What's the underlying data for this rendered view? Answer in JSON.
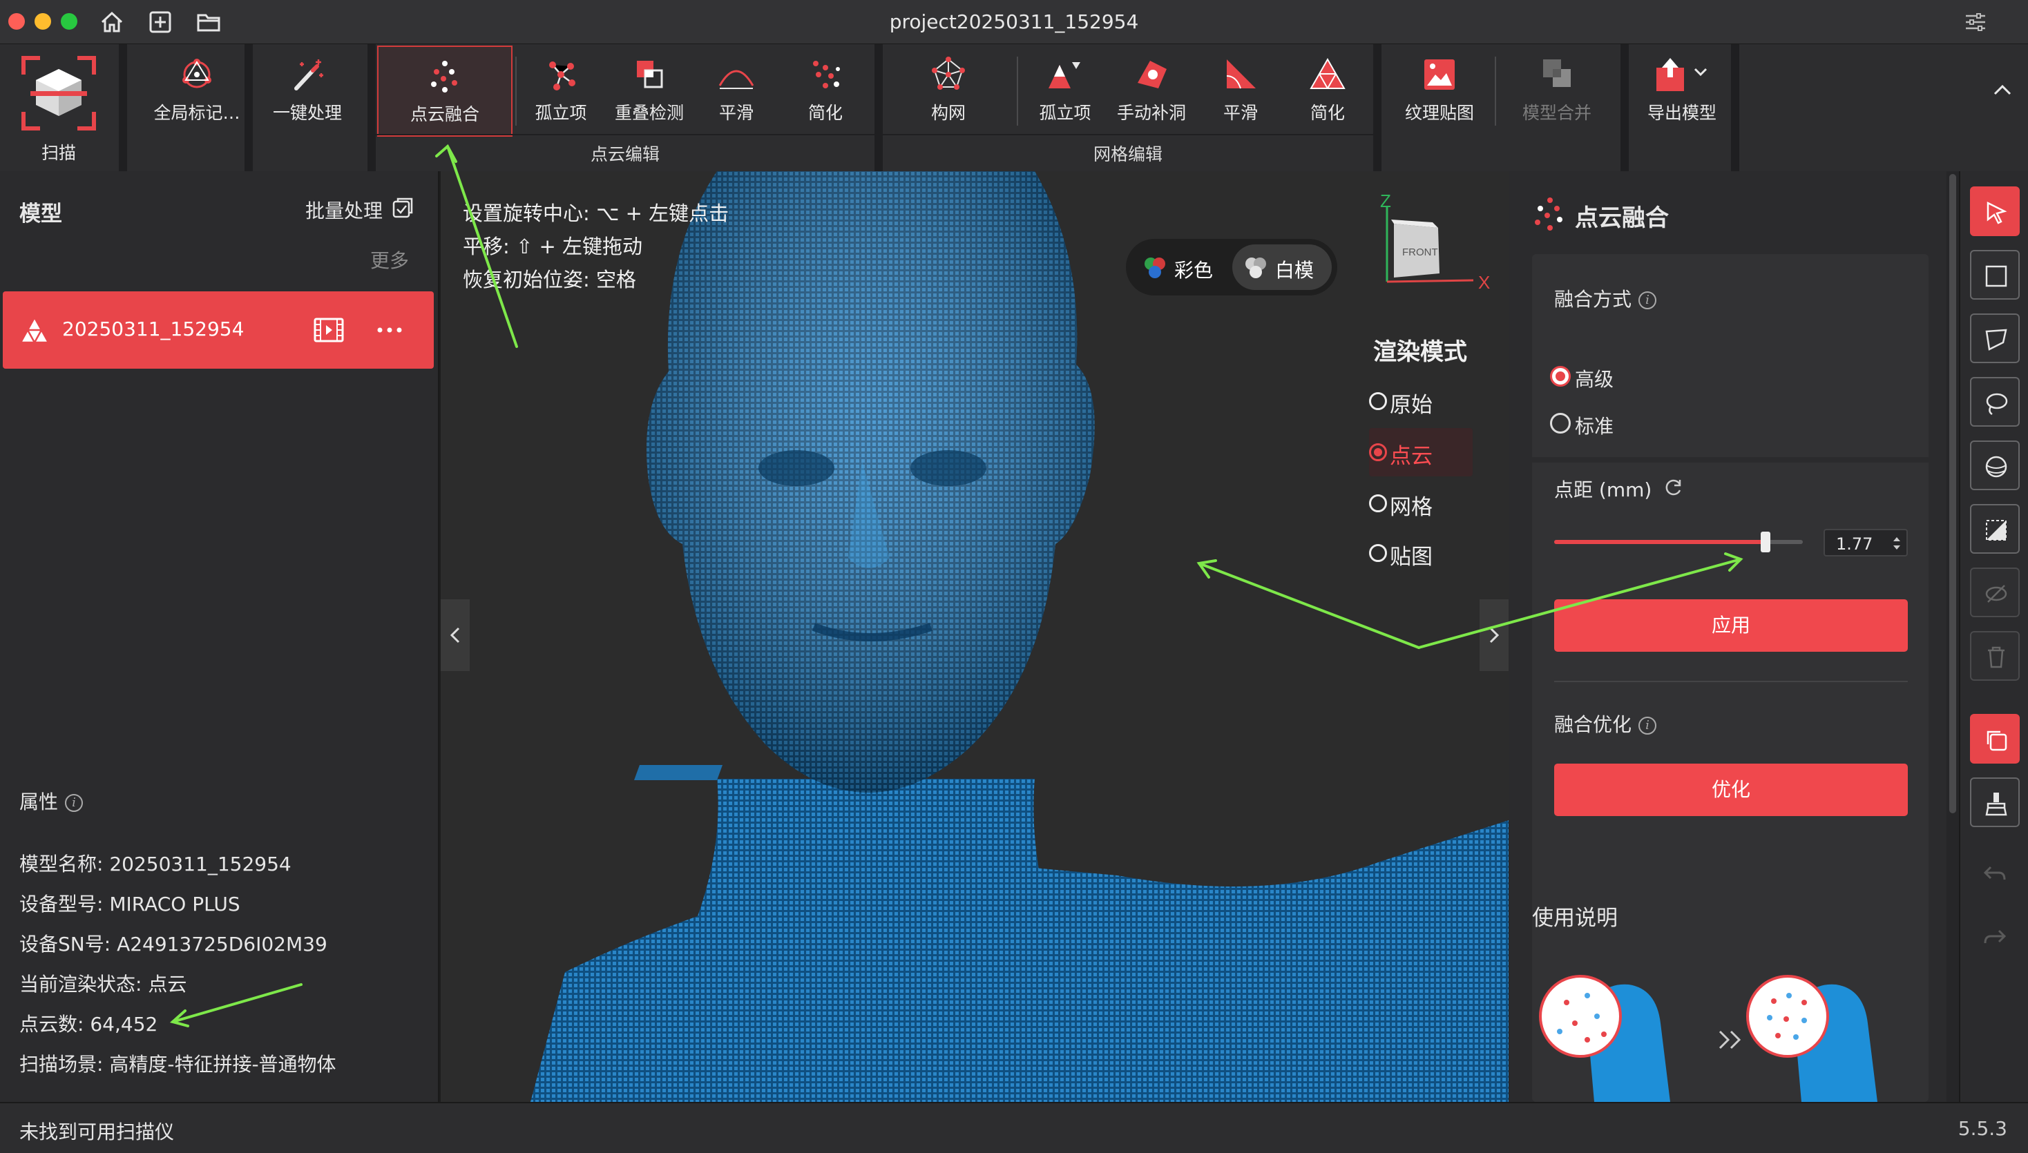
{
  "window": {
    "title": "project20250311_152954"
  },
  "ribbon": {
    "scan": {
      "label": "扫描"
    },
    "global_marker": {
      "label": "全局标记…"
    },
    "one_click": {
      "label": "一键处理"
    },
    "point_fusion": {
      "label": "点云融合"
    },
    "pc_isolated": {
      "label": "孤立项"
    },
    "overlap": {
      "label": "重叠检测"
    },
    "pc_smooth": {
      "label": "平滑"
    },
    "pc_simplify": {
      "label": "简化"
    },
    "build_mesh": {
      "label": "构网"
    },
    "mesh_isolated": {
      "label": "孤立项"
    },
    "manual_fill": {
      "label": "手动补洞"
    },
    "mesh_smooth": {
      "label": "平滑"
    },
    "mesh_simplify": {
      "label": "简化"
    },
    "texture": {
      "label": "纹理贴图"
    },
    "model_merge": {
      "label": "模型合并"
    },
    "export": {
      "label": "导出模型"
    },
    "group_point_cloud": "点云编辑",
    "group_mesh": "网格编辑"
  },
  "left_panel": {
    "models_title": "模型",
    "batch": "批量处理",
    "more": "更多",
    "model_item": "20250311_152954",
    "properties_title": "属性",
    "properties": [
      {
        "label": "模型名称:",
        "value": "20250311_152954"
      },
      {
        "label": "设备型号:",
        "value": "MIRACO PLUS"
      },
      {
        "label": "设备SN号:",
        "value": "A24913725D6I02M39"
      },
      {
        "label": "当前渲染状态:",
        "value": "点云"
      },
      {
        "label": "点云数:",
        "value": "64,452"
      },
      {
        "label": "扫描场景:",
        "value": "高精度-特征拼接-普通物体"
      }
    ]
  },
  "viewport": {
    "hints": [
      "设置旋转中心: ⌥ + 左键点击",
      "平移: ⇧ + 左键拖动",
      "恢复初始位姿: 空格"
    ],
    "color_mode": {
      "color": "彩色",
      "white": "白模"
    },
    "axis": {
      "z": "Z",
      "x": "X",
      "cube": "FRONT"
    },
    "render_mode": {
      "title": "渲染模式",
      "options": [
        "原始",
        "点云",
        "网格",
        "贴图"
      ],
      "selected": "点云"
    }
  },
  "right_panel": {
    "title": "点云融合",
    "fusion_method": "融合方式",
    "options": [
      "高级",
      "标准"
    ],
    "selected_option": "高级",
    "spacing_label": "点距 (mm)",
    "spacing_value": "1.77",
    "spacing_slider_fraction": 0.85,
    "apply": "应用",
    "optimize_title": "融合优化",
    "optimize": "优化",
    "instructions_title": "使用说明"
  },
  "status": {
    "message": "未找到可用扫描仪",
    "version": "5.5.3"
  },
  "colors": {
    "accent": "#e8454a",
    "model_blue": "#1a6ba8",
    "annotation_arrow": "#7ee84a"
  }
}
